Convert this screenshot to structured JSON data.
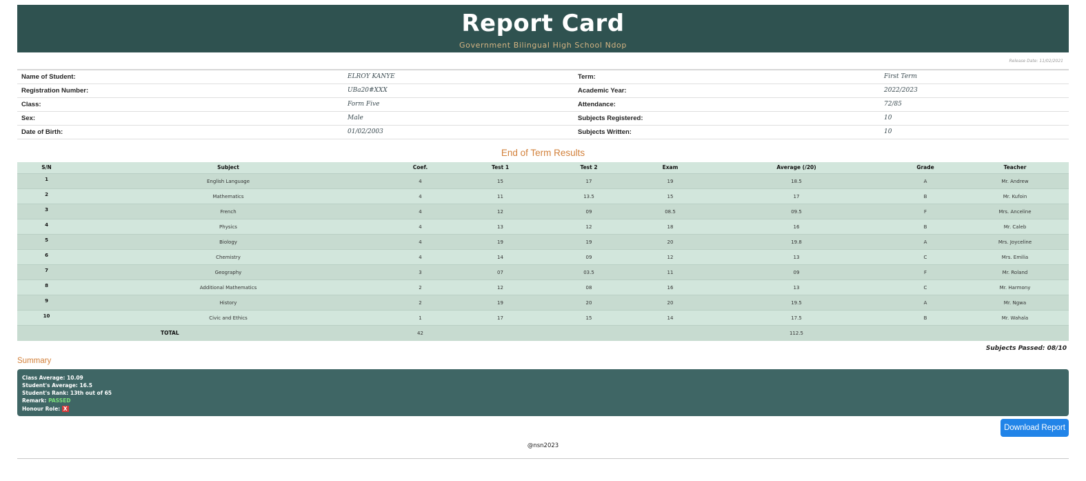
{
  "header": {
    "title": "Report Card",
    "school": "Government Bilingual High School Ndop"
  },
  "release_date": "Release Date: 11/02/2021",
  "student_info": [
    {
      "label": "Name of Student:",
      "value": "ELROY KANYE",
      "label2": "Term:",
      "value2": "First Term"
    },
    {
      "label": "Registration Number:",
      "value": "UBa20#XXX",
      "label2": "Academic Year:",
      "value2": "2022/2023"
    },
    {
      "label": "Class:",
      "value": "Form Five",
      "label2": "Attendance:",
      "value2": "72/85"
    },
    {
      "label": "Sex:",
      "value": "Male",
      "label2": "Subjects Registered:",
      "value2": "10"
    },
    {
      "label": "Date of Birth:",
      "value": "01/02/2003",
      "label2": "Subjects Written:",
      "value2": "10"
    }
  ],
  "results": {
    "title": "End of Term Results",
    "headers": [
      "S/N",
      "Subject",
      "Coef.",
      "Test 1",
      "Test 2",
      "Exam",
      "Average (/20)",
      "Grade",
      "Teacher"
    ],
    "rows": [
      [
        "1",
        "English Language",
        "4",
        "15",
        "17",
        "19",
        "18.5",
        "A",
        "Mr. Andrew"
      ],
      [
        "2",
        "Mathematics",
        "4",
        "11",
        "13.5",
        "15",
        "17",
        "B",
        "Mr. Kufoin"
      ],
      [
        "3",
        "French",
        "4",
        "12",
        "09",
        "08.5",
        "09.5",
        "F",
        "Mrs. Anceline"
      ],
      [
        "4",
        "Physics",
        "4",
        "13",
        "12",
        "18",
        "16",
        "B",
        "Mr. Caleb"
      ],
      [
        "5",
        "Biology",
        "4",
        "19",
        "19",
        "20",
        "19.8",
        "A",
        "Mrs. Joyceline"
      ],
      [
        "6",
        "Chemistry",
        "4",
        "14",
        "09",
        "12",
        "13",
        "C",
        "Mrs. Emilia"
      ],
      [
        "7",
        "Geography",
        "3",
        "07",
        "03.5",
        "11",
        "09",
        "F",
        "Mr. Roland"
      ],
      [
        "8",
        "Additional Mathematics",
        "2",
        "12",
        "08",
        "16",
        "13",
        "C",
        "Mr. Harmony"
      ],
      [
        "9",
        "History",
        "2",
        "19",
        "20",
        "20",
        "19.5",
        "A",
        "Mr. Ngwa"
      ],
      [
        "10",
        "Civic and Ethics",
        "1",
        "17",
        "15",
        "14",
        "17.5",
        "B",
        "Mr. Wahala"
      ]
    ],
    "total_label": "TOTAL",
    "total_coef": "42",
    "total_average": "112.5"
  },
  "subjects_passed": "Subjects Passed: 08/10",
  "summary": {
    "title": "Summary",
    "class_average_label": "Class Average:",
    "class_average": "10.09",
    "student_average_label": "Student's Average:",
    "student_average": "16.5",
    "rank_label": "Student's Rank:",
    "rank": "13th out of 65",
    "remark_label": "Remark:",
    "remark": "PASSED",
    "honour_label": "Honour Role:",
    "honour": "X"
  },
  "download_label": "Download Report",
  "footer": "@nsn2023"
}
